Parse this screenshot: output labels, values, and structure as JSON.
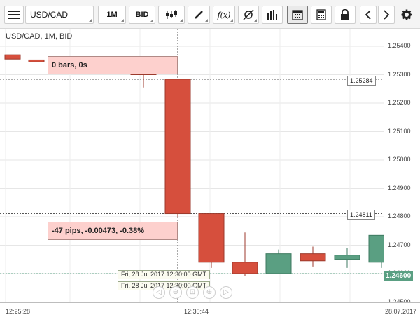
{
  "toolbar": {
    "symbol": "USD/CAD",
    "period": "1M",
    "side": "BID",
    "fx_label": "f(x)"
  },
  "chart": {
    "title": "USD/CAD, 1M, BID",
    "bars_box": "0 bars, 0s",
    "pips_box": "-47 pips, -0.00473, -0.38%",
    "price_tag_top": "1.25284",
    "price_tag_bottom": "1.24811",
    "current_price": "1.24600",
    "date_box_1": "Fri, 28 Jul 2017 12:30:00 GMT",
    "date_box_2": "Fri, 28 Jul 2017 12:30:00 GMT",
    "colors": {
      "up": "#5a9f82",
      "down": "#d64f3d",
      "box": "#fdd0cd"
    }
  },
  "price_axis": {
    "ticks": [
      "1.25400",
      "1.25300",
      "1.25200",
      "1.25100",
      "1.25000",
      "1.24900",
      "1.24800",
      "1.24700",
      "1.24600",
      "1.24500"
    ]
  },
  "time_axis": {
    "ticks": [
      "12:25:28",
      "12:30:44",
      "28.07.2017"
    ]
  },
  "candles": [
    {
      "o": 1.2537,
      "h": 1.2537,
      "l": 1.25355,
      "c": 1.25355
    },
    {
      "o": 1.25352,
      "h": 1.25352,
      "l": 1.25345,
      "c": 1.25345
    },
    {
      "o": 1.2531,
      "h": 1.2531,
      "l": 1.25255,
      "c": 1.253
    },
    {
      "o": 1.25284,
      "h": 1.25284,
      "l": 1.248,
      "c": 1.24811
    },
    {
      "o": 1.24811,
      "h": 1.24811,
      "l": 1.2462,
      "c": 1.2464
    },
    {
      "o": 1.2464,
      "h": 1.24745,
      "l": 1.2459,
      "c": 1.246
    },
    {
      "o": 1.246,
      "h": 1.24685,
      "l": 1.246,
      "c": 1.2467
    },
    {
      "o": 1.2467,
      "h": 1.24695,
      "l": 1.24625,
      "c": 1.24645
    },
    {
      "o": 1.2465,
      "h": 1.2469,
      "l": 1.2462,
      "c": 1.24665
    },
    {
      "o": 1.2464,
      "h": 1.24735,
      "l": 1.2462,
      "c": 1.24735
    }
  ]
}
